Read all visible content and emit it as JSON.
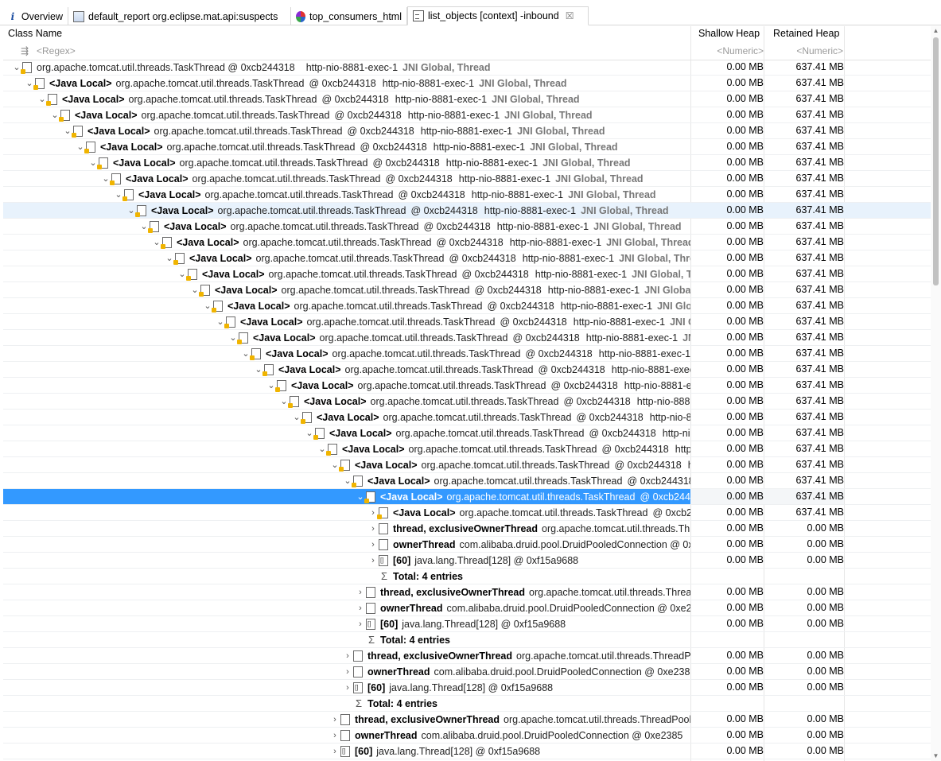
{
  "tabs": [
    {
      "icon": "info-icon",
      "label": "Overview",
      "active": false
    },
    {
      "icon": "report-icon",
      "label": "default_report  org.eclipse.mat.api:suspects",
      "active": false
    },
    {
      "icon": "html-icon",
      "label": "top_consumers_html",
      "active": false
    },
    {
      "icon": "list-icon",
      "label": "list_objects  [context] -inbound",
      "active": true,
      "close": "☒"
    }
  ],
  "columns": {
    "class_name": "Class Name",
    "shallow_heap": "Shallow Heap",
    "retained_heap": "Retained Heap",
    "filter_regex": "<Regex>",
    "filter_numeric_1": "<Numeric>",
    "filter_numeric_2": "<Numeric>"
  },
  "tree": {
    "java_local": "<Java Local>",
    "task_thread_class": "org.apache.tomcat.util.threads.TaskThread",
    "task_thread_addr": "@ 0xcb244318",
    "thread_name": "http-nio-8881-exec-1",
    "gc_roots": "JNI Global, Thread",
    "value_shallow": "0.00 MB",
    "value_retained": "637.41 MB",
    "value_zero": "0.00 MB",
    "root_row_label": "org.apache.tomcat.util.threads.TaskThread @ 0xcb244318",
    "thread_field": "thread, exclusiveOwnerThread",
    "thread_field_class": "org.apache.tomcat.util.threads.ThreadPoolExecutor$Worker",
    "owner_field": "ownerThread",
    "owner_field_class": "com.alibaba.druid.pool.DruidPooledConnection @ 0xe2385",
    "array_field": "[60]",
    "array_class": "java.lang.Thread[128] @ 0xf15a9688",
    "total": "Total: 4 entries"
  }
}
